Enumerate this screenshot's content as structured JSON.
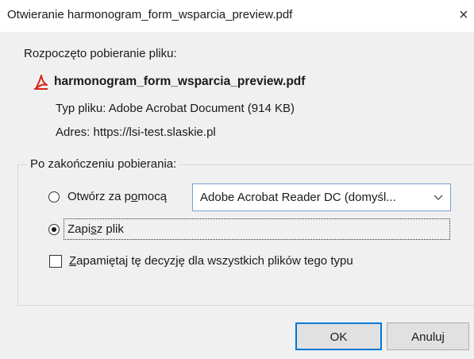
{
  "window": {
    "title": "Otwieranie harmonogram_form_wsparcia_preview.pdf",
    "close_glyph": "×"
  },
  "download": {
    "started_text": "Rozpoczęto pobieranie pliku:",
    "file_icon": "pdf-icon",
    "filename": "harmonogram_form_wsparcia_preview.pdf",
    "type_text": "Typ pliku: Adobe Acrobat Document (914 KB)",
    "address_text": "Adres: https://lsi-test.slaskie.pl"
  },
  "after_download": {
    "legend": "Po zakończeniu pobierania:",
    "open_with": {
      "label_pre": "Otwórz za p",
      "label_mnemonic": "o",
      "label_post": "mocą",
      "selected": false,
      "app_select_value": "Adobe Acrobat Reader DC  (domyśl...",
      "chevron_icon": "chevron-down-icon"
    },
    "save_file": {
      "label_pre": "Zapi",
      "label_mnemonic": "s",
      "label_post": "z plik",
      "selected": true
    },
    "remember": {
      "label_mnemonic": "Z",
      "label_post": "apamiętaj tę decyzję dla wszystkich plików tego typu",
      "checked": false
    }
  },
  "buttons": {
    "ok_label": "OK",
    "cancel_label": "Anuluj"
  },
  "colors": {
    "dialog_bg": "#f0f0f0",
    "titlebar_bg": "#ffffff",
    "accent_border": "#0078d7",
    "pdf_icon_red": "#d9261c"
  }
}
